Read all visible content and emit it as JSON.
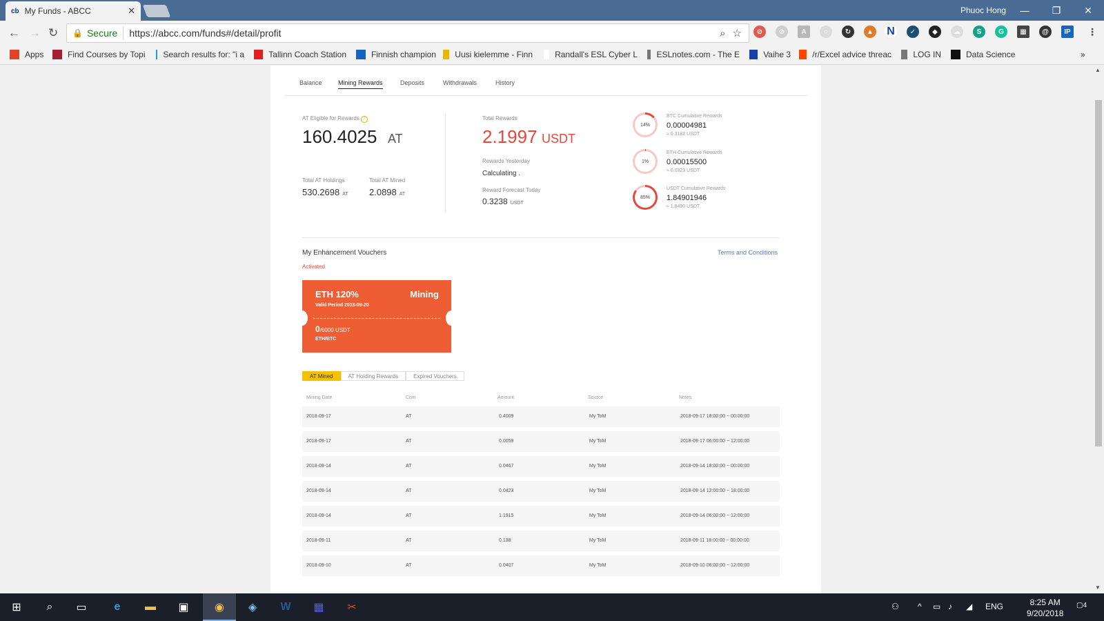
{
  "browser": {
    "tab_title": "My Funds - ABCC",
    "tab_favicon": "cb",
    "profile_name": "Phuoc Hong",
    "secure_label": "Secure",
    "url": "https://abcc.com/funds#/detail/profit",
    "bookmarks": [
      {
        "label": "Apps",
        "icon": "apps-grid-icon",
        "color": "#e0452b"
      },
      {
        "label": "Find Courses by Topi",
        "icon": "mit-icon",
        "color": "#a31f34"
      },
      {
        "label": "Search results for: \"i a",
        "icon": "search-result-icon",
        "color": "#2196f3"
      },
      {
        "label": "Tallinn Coach Station",
        "icon": "star-red-icon",
        "color": "#e02020"
      },
      {
        "label": "Finnish champion",
        "icon": "s-icon",
        "color": "#1565c0"
      },
      {
        "label": "Uusi kielemme - Finn",
        "icon": "star-badge-icon",
        "color": "#e6b800"
      },
      {
        "label": "Randall's ESL Cyber L",
        "icon": "esl-icon",
        "color": "#ffffff"
      },
      {
        "label": "ESLnotes.com - The E",
        "icon": "page-icon",
        "color": "#777777"
      },
      {
        "label": "Vaihe 3",
        "icon": "m-icon",
        "color": "#1a3fa6"
      },
      {
        "label": "/r/Excel advice threac",
        "icon": "reddit-icon",
        "color": "#ff4500"
      },
      {
        "label": "LOG IN",
        "icon": "page-icon",
        "color": "#777777"
      },
      {
        "label": "Data Science",
        "icon": "itu-icon",
        "color": "#111111"
      }
    ]
  },
  "subnav": {
    "items": [
      "Balance",
      "Mining Rewards",
      "Deposits",
      "Withdrawals",
      "History"
    ],
    "active": "Mining Rewards"
  },
  "summary": {
    "eligible_label": "AT Eligible for Rewards",
    "eligible_value": "160.4025",
    "eligible_unit": "AT",
    "holdings_label": "Total AT Holdings",
    "holdings_value": "530.2698",
    "holdings_unit": "AT",
    "mined_label": "Total AT Mined",
    "mined_value": "2.0898",
    "mined_unit": "AT",
    "total_rewards_label": "Total Rewards",
    "total_rewards_value": "2.1997",
    "total_rewards_unit": "USDT",
    "yesterday_label": "Rewards Yesterday",
    "yesterday_value": "Calculating .",
    "forecast_label": "Reward Forecast Today",
    "forecast_value": "0.3238",
    "forecast_unit": "USDT"
  },
  "cumulative": [
    {
      "label": "BTC Cumulative Rewards",
      "value": "0.00004981",
      "sub": "≈ 0.3182 USDT",
      "percent_text": "14%",
      "fraction": 0.14
    },
    {
      "label": "ETH Cumulative Rewards",
      "value": "0.00015500",
      "sub": "≈ 0.0323 USDT",
      "percent_text": "1%",
      "fraction": 0.01
    },
    {
      "label": "USDT Cumulative Rewards",
      "value": "1.84901946",
      "sub": "≈ 1.8490 USDT",
      "percent_text": "85%",
      "fraction": 0.85
    }
  ],
  "vouchers": {
    "title": "My Enhancement Vouchers",
    "terms": "Terms and Conditions",
    "status": "Activated",
    "card": {
      "coin": "ETH  120%",
      "type": "Mining",
      "period": "Valid Period   2018-09-20",
      "amount": "0",
      "amount_total": "/6000 USDT",
      "pair": "ETH/BTC"
    }
  },
  "table_tabs": [
    "AT Mined",
    "AT Holding Rewards",
    "Expired Vouchers"
  ],
  "table": {
    "columns": [
      "Mining Date",
      "Coin",
      "Amount",
      "Source",
      "Notes"
    ],
    "rows": [
      [
        "2018-09-17",
        "AT",
        "0.4009",
        "My ToM",
        "2018-09-17 18:00:00 ~ 00:00:00"
      ],
      [
        "2018-09-17",
        "AT",
        "0.0059",
        "My ToM",
        "2018-09-17 06:00:00 ~ 12:00:00"
      ],
      [
        "2018-09-14",
        "AT",
        "0.0467",
        "My ToM",
        "2018-09-14 18:00:00 ~ 00:00:00"
      ],
      [
        "2018-09-14",
        "AT",
        "0.0423",
        "My ToM",
        "2018-09-14 12:00:00 ~ 18:00:00"
      ],
      [
        "2018-09-14",
        "AT",
        "1.1915",
        "My ToM",
        "2018-09-14 06:00:00 ~ 12:00:00"
      ],
      [
        "2018-09-11",
        "AT",
        "0.138",
        "My ToM",
        "2018-09-11 18:00:00 ~ 00:00:00"
      ],
      [
        "2018-09-10",
        "AT",
        "0.0407",
        "My ToM",
        "2018-09-10 06:00:00 ~ 12:00:00"
      ]
    ]
  },
  "taskbar": {
    "language": "ENG",
    "time": "8:25 AM",
    "date": "9/20/2018",
    "notifications": "4"
  },
  "colors": {
    "accent_red": "#e8463a",
    "voucher_orange": "#ef5d35",
    "tab_active_yellow": "#f5c000",
    "link_blue": "#5a7fa8"
  }
}
